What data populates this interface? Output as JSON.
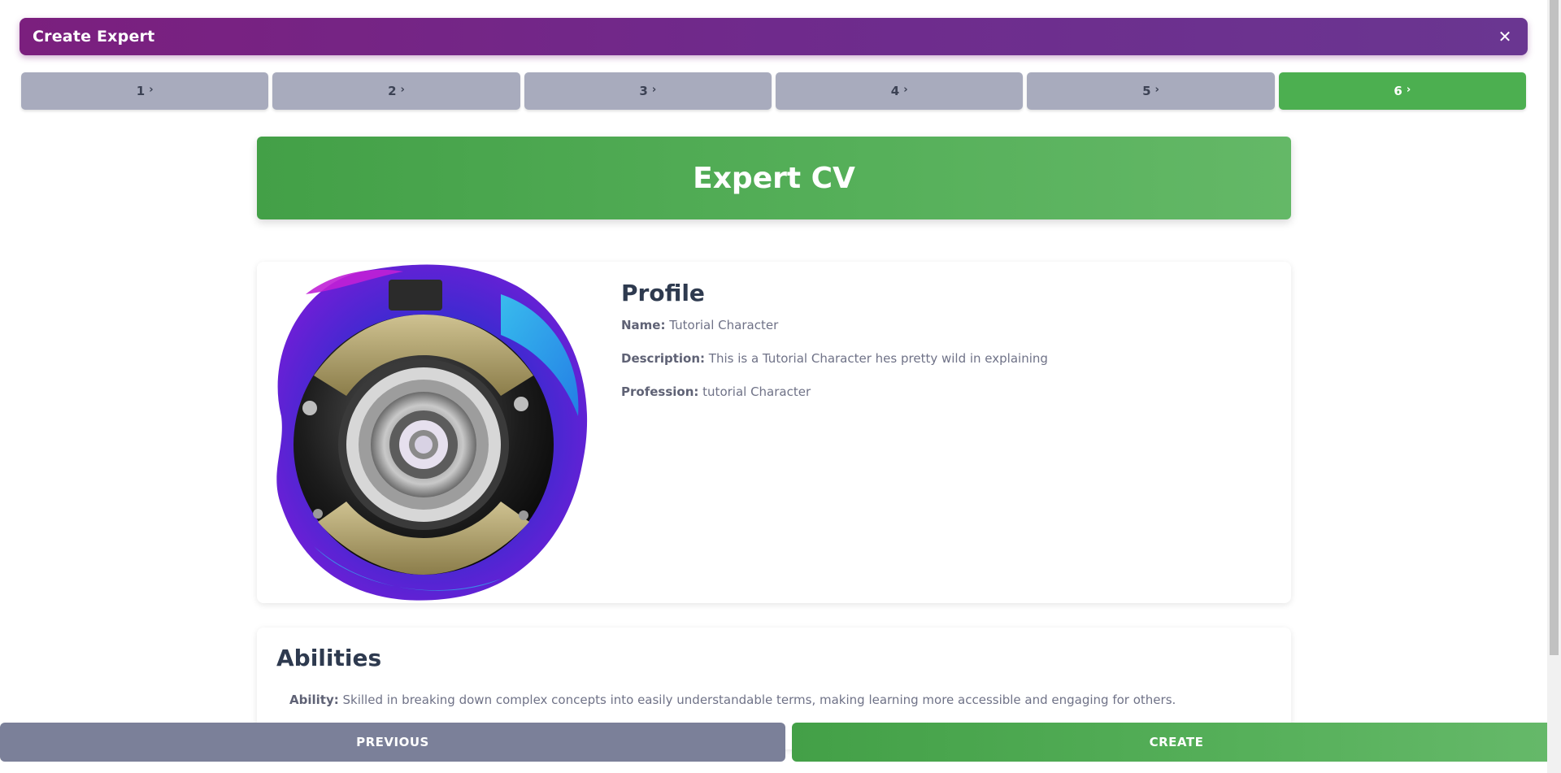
{
  "header": {
    "title": "Create Expert",
    "close_icon": "close-icon",
    "gradient_start": "#7b1f7e",
    "gradient_end": "#6a3691"
  },
  "steps": [
    {
      "label": "1",
      "active": false
    },
    {
      "label": "2",
      "active": false
    },
    {
      "label": "3",
      "active": false
    },
    {
      "label": "4",
      "active": false
    },
    {
      "label": "5",
      "active": false
    },
    {
      "label": "6",
      "active": true
    }
  ],
  "step_chevron": "›",
  "banner": {
    "title": "Expert CV",
    "color": "#4caf50"
  },
  "profile": {
    "heading": "Profile",
    "name_label": "Name:",
    "name_value": "Tutorial Character",
    "description_label": "Description:",
    "description_value": "This is a Tutorial Character hes pretty wild in explaining",
    "profession_label": "Profession:",
    "profession_value": "tutorial Character"
  },
  "abilities": {
    "heading": "Abilities",
    "ability_label": "Ability:",
    "ability_value": "Skilled in breaking down complex concepts into easily understandable terms, making learning more accessible and engaging for others."
  },
  "footer": {
    "previous_label": "PREVIOUS",
    "create_label": "CREATE"
  },
  "colors": {
    "step_inactive": "#a8abbd",
    "step_active": "#4caf50",
    "previous_button": "#7b8099",
    "heading_text": "#2e3a4f"
  }
}
